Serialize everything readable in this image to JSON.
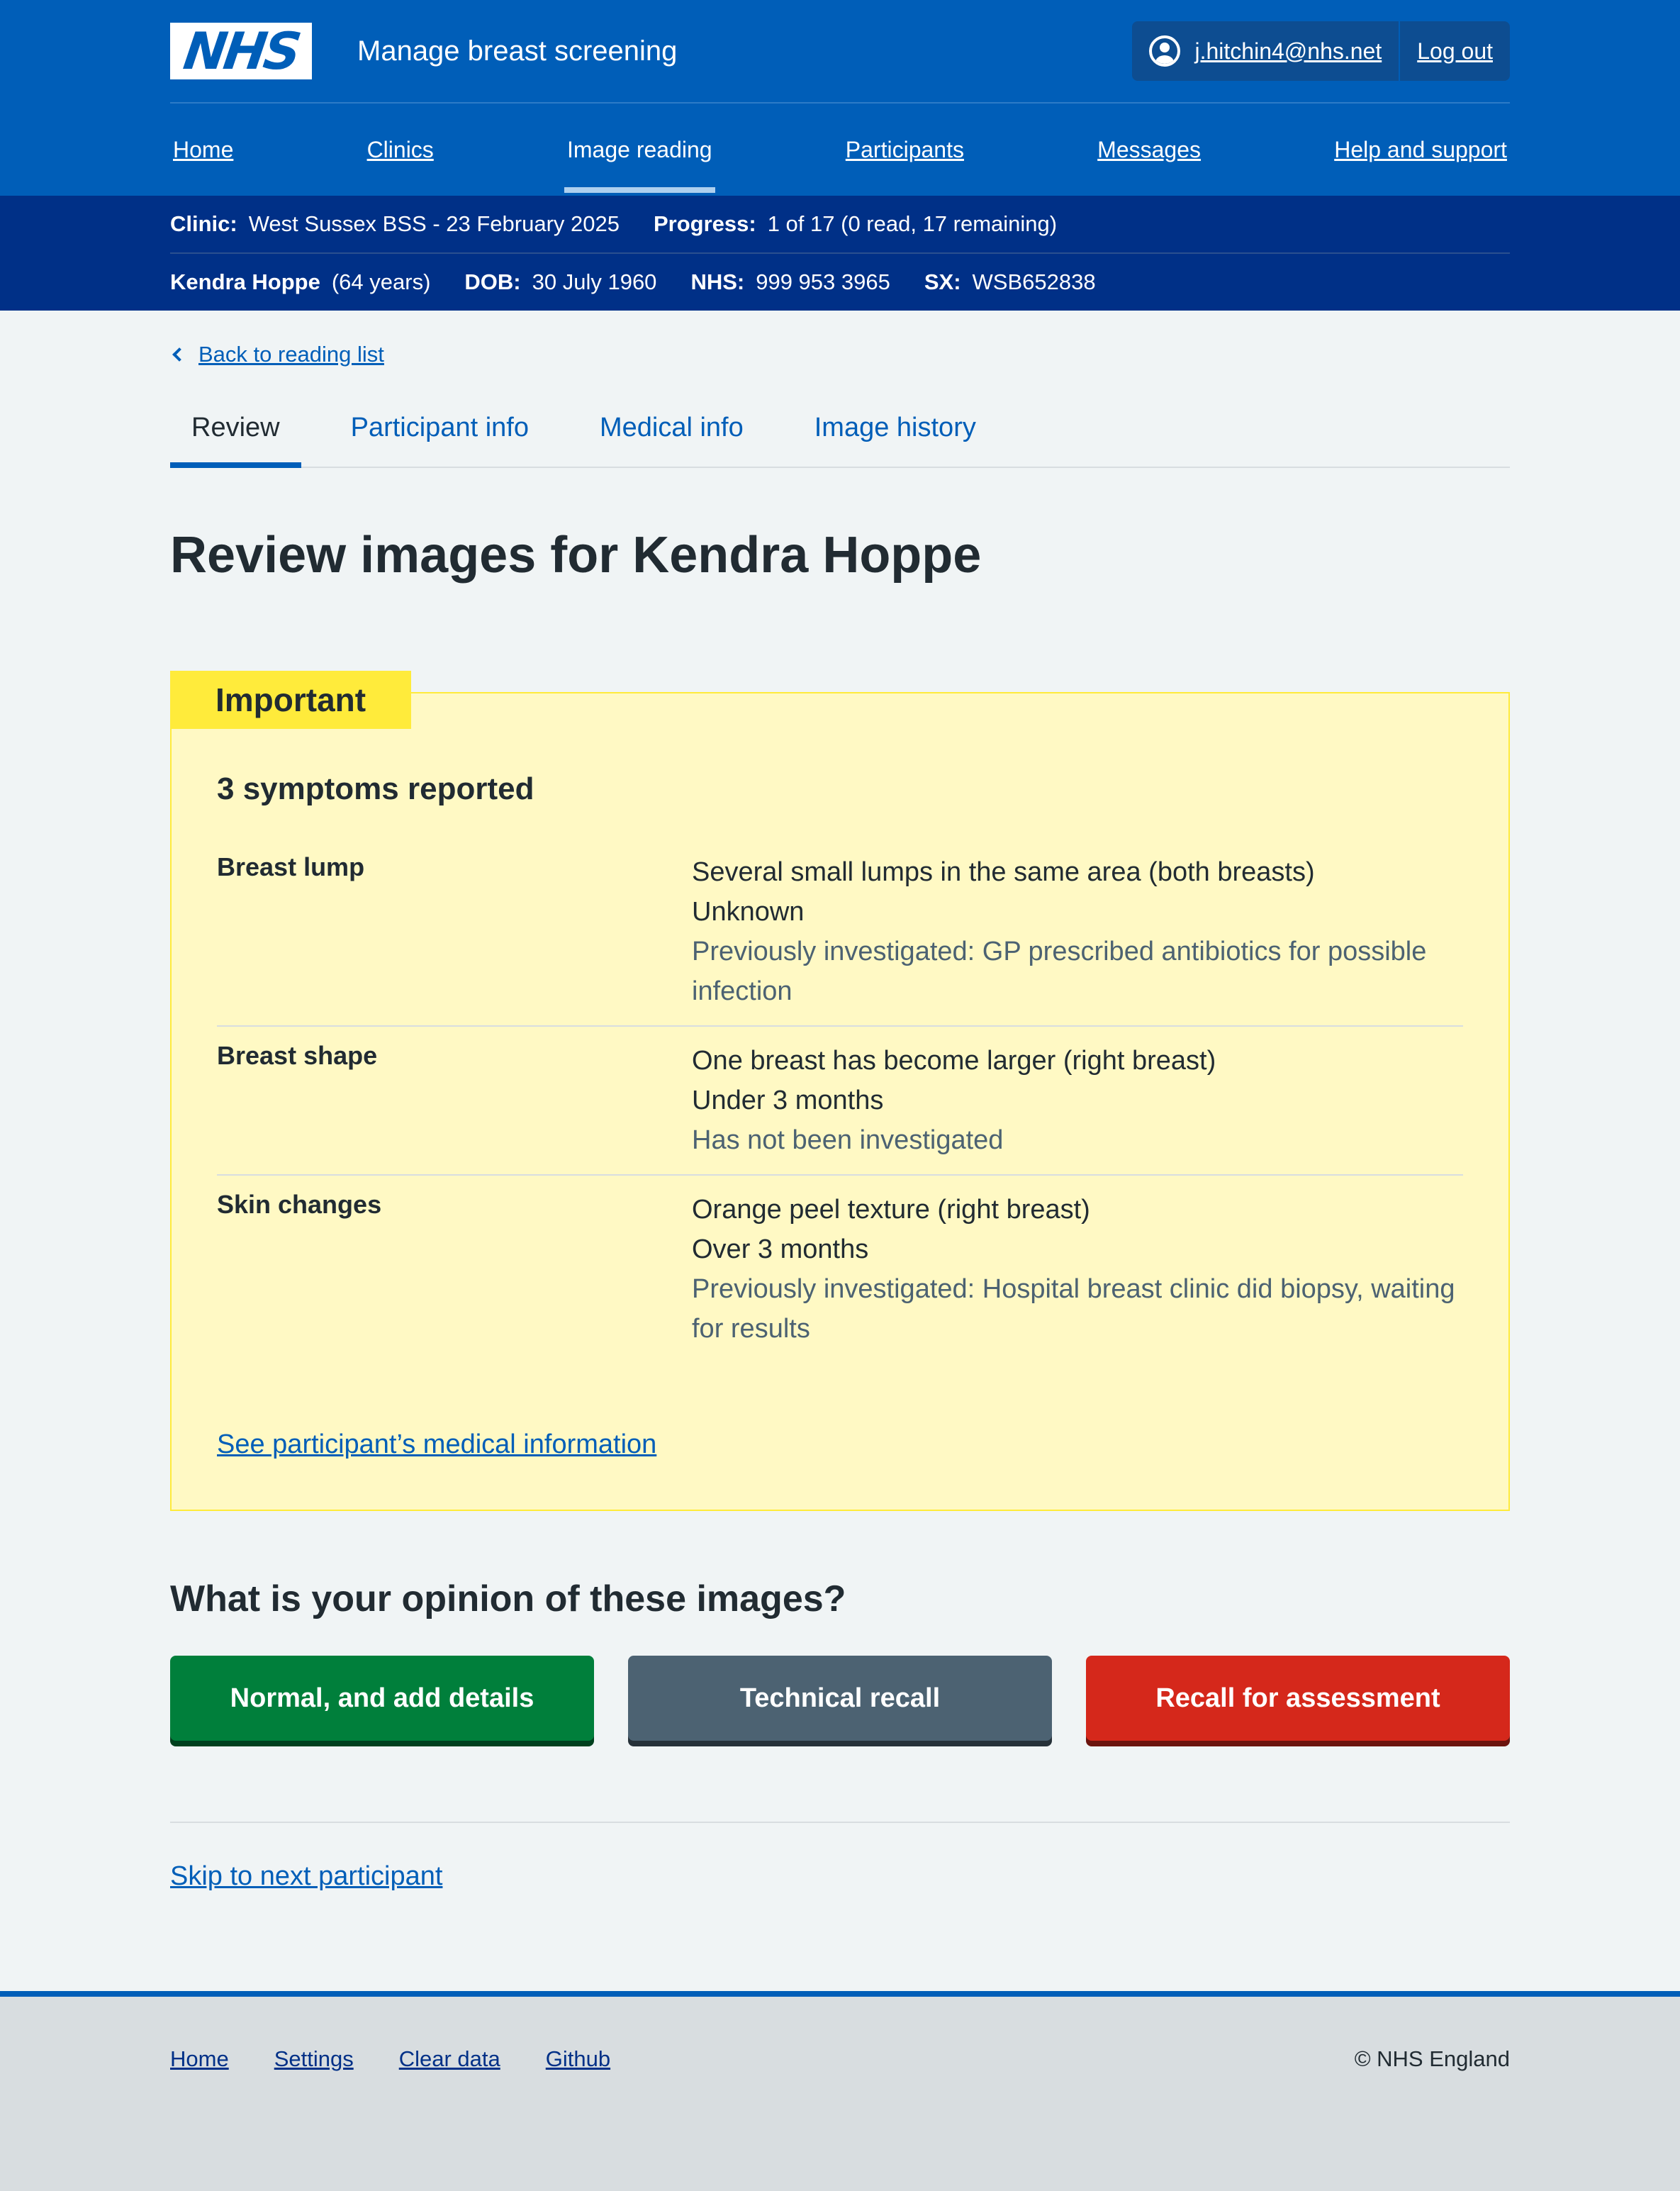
{
  "header": {
    "logo_text": "NHS",
    "service_name": "Manage breast screening",
    "user_email": "j.hitchin4@nhs.net",
    "logout_label": "Log out",
    "nav": [
      "Home",
      "Clinics",
      "Image reading",
      "Participants",
      "Messages",
      "Help and support"
    ],
    "active_nav": "Image reading"
  },
  "context": {
    "clinic_label": "Clinic:",
    "clinic_value": "West Sussex BSS - 23 February 2025",
    "progress_label": "Progress:",
    "progress_value": "1 of 17 (0 read, 17 remaining)",
    "participant_name": "Kendra Hoppe",
    "participant_age": "(64 years)",
    "dob_label": "DOB:",
    "dob_value": "30 July 1960",
    "nhs_label": "NHS:",
    "nhs_value": "999 953 3965",
    "sx_label": "SX:",
    "sx_value": "WSB652838"
  },
  "back_link": "Back to reading list",
  "tabs": [
    "Review",
    "Participant info",
    "Medical info",
    "Image history"
  ],
  "page_title": "Review images for Kendra Hoppe",
  "warning": {
    "label": "Important",
    "heading": "3 symptoms reported",
    "symptoms": [
      {
        "name": "Breast lump",
        "description": "Several small lumps in the same area (both breasts)",
        "duration": "Unknown",
        "investigation": "Previously investigated: GP prescribed antibiotics for possible infection"
      },
      {
        "name": "Breast shape",
        "description": "One breast has become larger (right breast)",
        "duration": "Under 3 months",
        "investigation": "Has not been investigated"
      },
      {
        "name": "Skin changes",
        "description": "Orange peel texture (right breast)",
        "duration": "Over 3 months",
        "investigation": "Previously investigated: Hospital breast clinic did biopsy, waiting for results"
      }
    ],
    "link": "See participant’s medical information"
  },
  "opinion": {
    "heading": "What is your opinion of these images?",
    "normal_label": "Normal, and add details",
    "technical_label": "Technical recall",
    "recall_label": "Recall for assessment"
  },
  "skip_link": "Skip to next participant",
  "footer": {
    "links": [
      "Home",
      "Settings",
      "Clear data",
      "Github"
    ],
    "copyright": "© NHS England"
  },
  "colors": {
    "nhs_blue": "#005eb8",
    "dark_blue": "#003087",
    "warning_yellow": "#ffeb3b",
    "green": "#007f3b",
    "grey": "#4c6272",
    "red": "#d5281b"
  }
}
